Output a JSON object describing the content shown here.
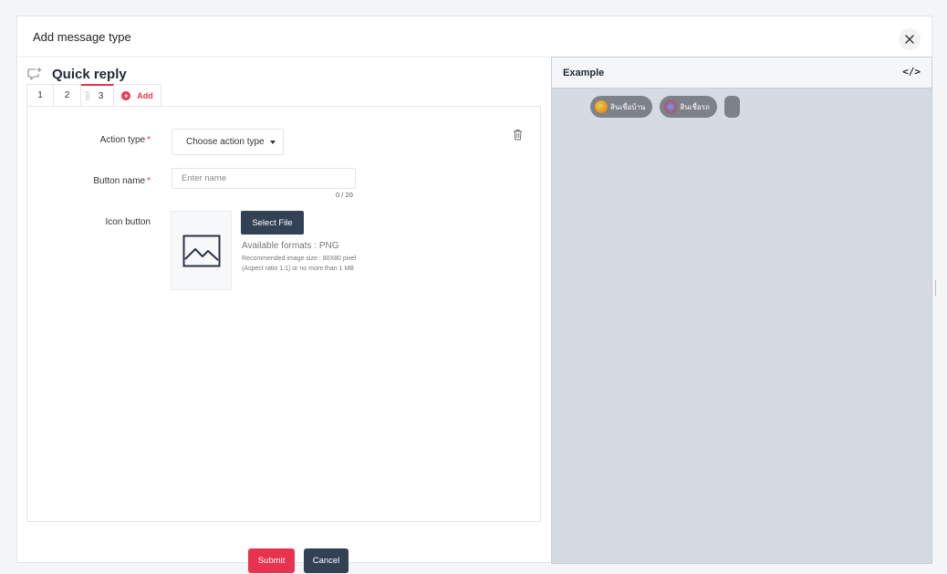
{
  "modal": {
    "title": "Add message type"
  },
  "editor": {
    "section_title": "Quick reply",
    "tabs": [
      {
        "label": "1"
      },
      {
        "label": "2"
      },
      {
        "label": "3",
        "active": true
      }
    ],
    "add_tab_label": "Add",
    "form": {
      "action_type_label": "Action type",
      "action_type_value": "Choose action type",
      "button_name_label": "Button name",
      "button_name_placeholder": "Enter name",
      "button_name_value": "",
      "button_name_counter": "0 / 20",
      "icon_button_label": "Icon button",
      "select_file_label": "Select File",
      "formats_text": "Available formats : PNG",
      "hint_text": "Recommended image size : 80X80 pixel (Aspect ratio 1:1) or no more than 1 MB",
      "required_mark": "*"
    },
    "submit_label": "Submit",
    "cancel_label": "Cancel"
  },
  "example": {
    "title": "Example",
    "code_toggle": "</>",
    "chips": [
      {
        "label": "สินเชื่อบ้าน",
        "icon": "house-emoji-icon"
      },
      {
        "label": "สินเชื่อรถ",
        "icon": "car-emoji-icon"
      },
      {
        "label": "",
        "icon": ""
      }
    ]
  },
  "colors": {
    "accent": "#e8334f",
    "dark_button": "#334155",
    "preview_bg": "#d6dbe2",
    "chip_bg": "#7d8189"
  }
}
